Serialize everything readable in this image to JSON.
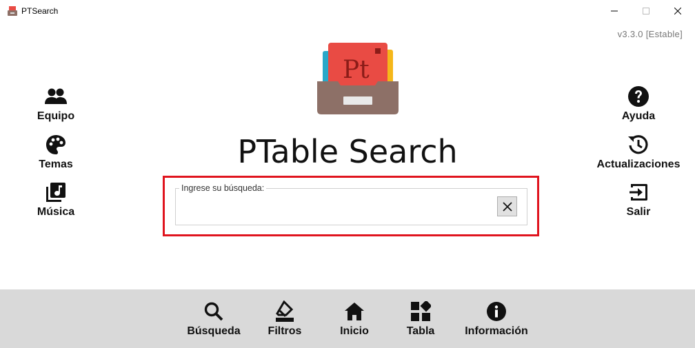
{
  "window": {
    "title": "PTSearch",
    "app_icon": "ptsearch-app-icon",
    "controls": [
      "minimize-icon",
      "maximize-icon",
      "close-icon"
    ]
  },
  "version": "v3.3.0 [Estable]",
  "app_title": "PTable Search",
  "logo": {
    "icon": "ptable-logo",
    "text": "Pt"
  },
  "left_menu": [
    {
      "label": "Equipo",
      "icon": "people-icon"
    },
    {
      "label": "Temas",
      "icon": "palette-icon"
    },
    {
      "label": "Música",
      "icon": "music-library-icon"
    }
  ],
  "right_menu": [
    {
      "label": "Ayuda",
      "icon": "help-icon"
    },
    {
      "label": "Actualizaciones",
      "icon": "update-icon"
    },
    {
      "label": "Salir",
      "icon": "exit-icon"
    }
  ],
  "search": {
    "legend": "Ingrese su búsqueda:",
    "value": "",
    "placeholder": "",
    "clear_icon": "clear-icon"
  },
  "bottom_nav": [
    {
      "label": "Búsqueda",
      "icon": "search-icon"
    },
    {
      "label": "Filtros",
      "icon": "filter-eraser-icon"
    },
    {
      "label": "Inicio",
      "icon": "home-icon"
    },
    {
      "label": "Tabla",
      "icon": "grid-icon"
    },
    {
      "label": "Información",
      "icon": "info-icon"
    }
  ],
  "colors": {
    "highlight": "#e0141e",
    "bottom_bar": "#d9d9d9",
    "logo_red": "#e94b44",
    "logo_brown": "#8d7067"
  }
}
